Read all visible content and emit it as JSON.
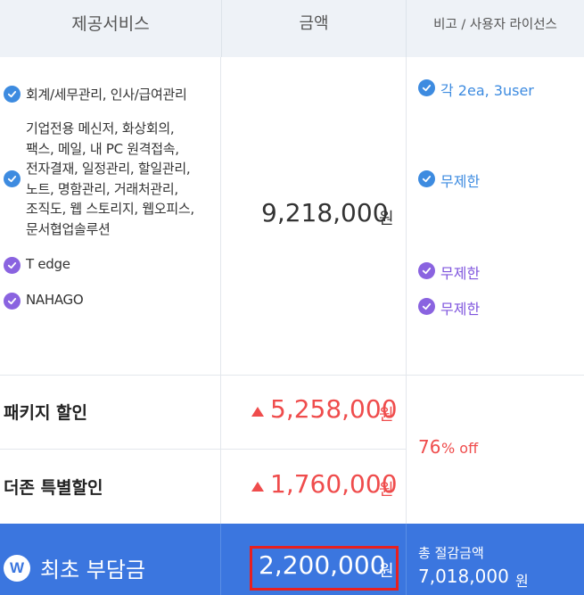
{
  "header": {
    "col_service": "제공서비스",
    "col_amount": "금액",
    "col_license": "비고 / 사용자 라이선스"
  },
  "services": [
    {
      "label": "회계/세무관리, 인사/급여관리",
      "icon": "check-circle-icon",
      "color": "#3d8be0"
    },
    {
      "lines": [
        "기업전용 메신저, 화상회의,",
        "팩스, 메일, 내 PC 원격접속,",
        "전자결재, 일정관리, 할일관리,",
        "노트, 명함관리, 거래처관리,",
        "조직도, 웹 스토리지, 웹오피스,",
        "문서협업솔루션"
      ],
      "icon": "check-circle-icon",
      "color": "#3d8be0"
    },
    {
      "label": "T edge",
      "icon": "check-circle-icon",
      "color": "#8a63e0"
    },
    {
      "label": "NAHAGO",
      "icon": "check-circle-icon",
      "color": "#8a63e0"
    }
  ],
  "base_amount": {
    "value": "9,218,000",
    "unit": "원"
  },
  "licenses": [
    {
      "label": "각 2ea, 3user",
      "color": "#3d8be0"
    },
    {
      "label": "무제한",
      "color": "#3d8be0"
    },
    {
      "label": "무제한",
      "color": "#8a63e0"
    },
    {
      "label": "무제한",
      "color": "#8a63e0"
    }
  ],
  "discounts": [
    {
      "label": "패키지 할인",
      "value": "5,258,000",
      "unit": "원"
    },
    {
      "label": "더존 특별할인",
      "value": "1,760,000",
      "unit": "원"
    }
  ],
  "discount_rate": {
    "value": "76",
    "suffix": "% off"
  },
  "footer": {
    "logo_letter": "W",
    "label": "최초 부담금",
    "amount": "2,200,000",
    "unit": "원",
    "savings_label": "총 절감금액",
    "savings_amount": "7,018,000",
    "savings_unit": "원"
  },
  "colors": {
    "accent_blue": "#3b76df",
    "discount_red": "#ef4c4c",
    "highlight_box": "#e8201f"
  }
}
